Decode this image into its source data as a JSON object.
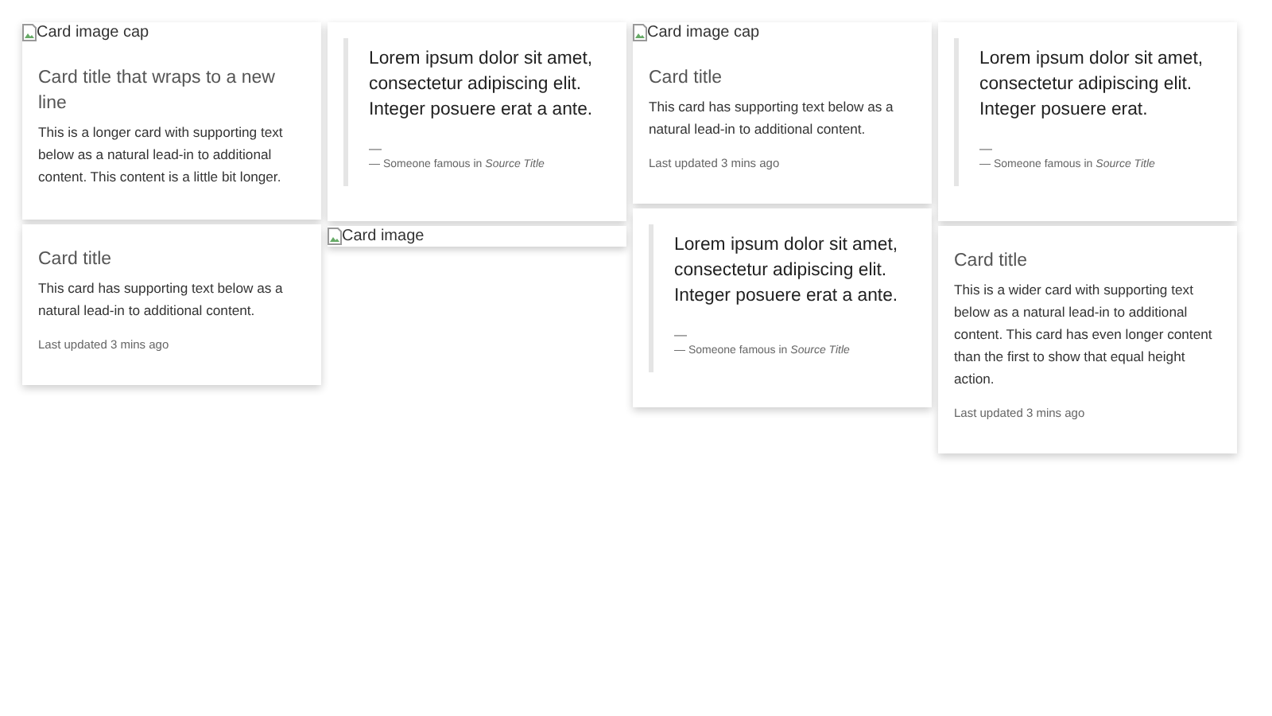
{
  "columns": [
    {
      "cards": [
        {
          "kind": "text",
          "image_alt": "Card image cap",
          "title": "Card title that wraps to a new line",
          "text": "This is a longer card with supporting text below as a natural lead-in to additional content. This content is a little bit longer."
        },
        {
          "kind": "text",
          "title": "Card title",
          "text": "This card has supporting text below as a natural lead-in to additional content.",
          "note": "Last updated 3 mins ago"
        }
      ]
    },
    {
      "cards": [
        {
          "kind": "quote",
          "quote": "Lorem ipsum dolor sit amet, consectetur adipiscing elit. Integer posuere erat a ante.",
          "dash": "—",
          "footer": "— Someone famous in *Source Title*"
        },
        {
          "kind": "image",
          "image_alt": "Card image"
        }
      ]
    },
    {
      "cards": [
        {
          "kind": "text",
          "image_alt": "Card image cap",
          "title": "Card title",
          "text": "This card has supporting text below as a natural lead-in to additional content.",
          "note": "Last updated 3 mins ago"
        },
        {
          "kind": "quote",
          "quote": "Lorem ipsum dolor sit amet, consectetur adipiscing elit. Integer posuere erat a ante.",
          "dash": "—",
          "footer": "— Someone famous in *Source Title*"
        }
      ]
    },
    {
      "cards": [
        {
          "kind": "quote",
          "quote": "Lorem ipsum dolor sit amet, consectetur adipiscing elit. Integer posuere erat.",
          "dash": "—",
          "footer": "— Someone famous in *Source Title*"
        },
        {
          "kind": "text",
          "title": "Card title",
          "text": "This is a wider card with supporting text below as a natural lead-in to additional content. This card has even longer content than the first to show that equal height action.",
          "note": "Last updated 3 mins ago"
        }
      ]
    }
  ]
}
